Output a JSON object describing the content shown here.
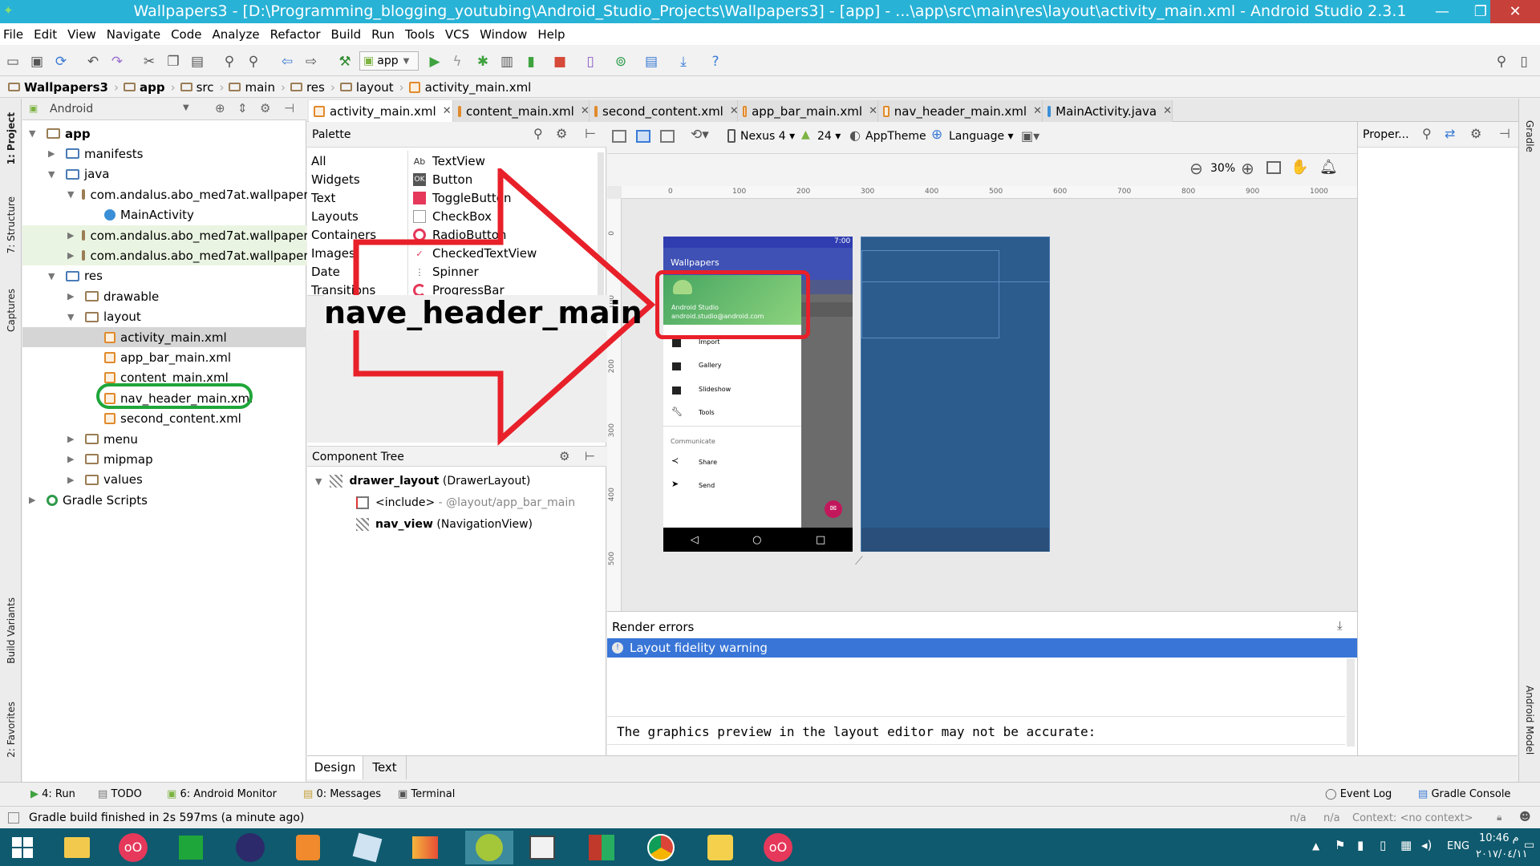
{
  "window": {
    "title": "Wallpapers3 - [D:\\Programming_blogging_youtubing\\Android_Studio_Projects\\Wallpapers3] - [app] - ...\\app\\src\\main\\res\\layout\\activity_main.xml - Android Studio 2.3.1",
    "controls": {
      "minimize": "—",
      "maximize": "❐",
      "close": "✕"
    }
  },
  "menu": [
    "File",
    "Edit",
    "View",
    "Navigate",
    "Code",
    "Analyze",
    "Refactor",
    "Build",
    "Run",
    "Tools",
    "VCS",
    "Window",
    "Help"
  ],
  "toolbar": {
    "run_config": "app"
  },
  "breadcrumb": [
    "Wallpapers3",
    "app",
    "src",
    "main",
    "res",
    "layout",
    "activity_main.xml"
  ],
  "left_tool_tabs": [
    "1: Project",
    "7: Structure",
    "Captures",
    "Build Variants",
    "2: Favorites"
  ],
  "right_tool_tabs": [
    "Gradle",
    "Android Model"
  ],
  "project": {
    "view_mode": "Android",
    "tree": [
      {
        "label": "app",
        "depth": 0,
        "open": true,
        "kind": "module"
      },
      {
        "label": "manifests",
        "depth": 1,
        "open": false,
        "kind": "folder"
      },
      {
        "label": "java",
        "depth": 1,
        "open": true,
        "kind": "folder"
      },
      {
        "label": "com.andalus.abo_med7at.wallpapers",
        "depth": 2,
        "open": true,
        "kind": "package"
      },
      {
        "label": "MainActivity",
        "depth": 3,
        "kind": "class"
      },
      {
        "label": "com.andalus.abo_med7at.wallpapers",
        "depth": 2,
        "open": false,
        "kind": "package",
        "highlight": true
      },
      {
        "label": "com.andalus.abo_med7at.wallpapers",
        "depth": 2,
        "open": false,
        "kind": "package",
        "highlight": true
      },
      {
        "label": "res",
        "depth": 1,
        "open": true,
        "kind": "folder"
      },
      {
        "label": "drawable",
        "depth": 2,
        "open": false,
        "kind": "folder"
      },
      {
        "label": "layout",
        "depth": 2,
        "open": true,
        "kind": "folder"
      },
      {
        "label": "activity_main.xml",
        "depth": 3,
        "kind": "xml",
        "selected": true
      },
      {
        "label": "app_bar_main.xml",
        "depth": 3,
        "kind": "xml"
      },
      {
        "label": "content_main.xml",
        "depth": 3,
        "kind": "xml"
      },
      {
        "label": "nav_header_main.xml",
        "depth": 3,
        "kind": "xml",
        "circled": true
      },
      {
        "label": "second_content.xml",
        "depth": 3,
        "kind": "xml"
      },
      {
        "label": "menu",
        "depth": 2,
        "open": false,
        "kind": "folder"
      },
      {
        "label": "mipmap",
        "depth": 2,
        "open": false,
        "kind": "folder"
      },
      {
        "label": "values",
        "depth": 2,
        "open": false,
        "kind": "folder"
      },
      {
        "label": "Gradle Scripts",
        "depth": 0,
        "open": false,
        "kind": "gradle"
      }
    ]
  },
  "editor_tabs": [
    {
      "label": "activity_main.xml",
      "active": true
    },
    {
      "label": "content_main.xml",
      "active": false
    },
    {
      "label": "second_content.xml",
      "active": false
    },
    {
      "label": "app_bar_main.xml",
      "active": false
    },
    {
      "label": "nav_header_main.xml",
      "active": false
    },
    {
      "label": "MainActivity.java",
      "active": false
    }
  ],
  "palette": {
    "title": "Palette",
    "categories": [
      "All",
      "Widgets",
      "Text",
      "Layouts",
      "Containers",
      "Images",
      "Date",
      "Transitions"
    ],
    "items": [
      {
        "icon": "Ab",
        "label": "TextView"
      },
      {
        "icon": "OK",
        "label": "Button"
      },
      {
        "icon": "",
        "label": "ToggleButton"
      },
      {
        "icon": "",
        "label": "CheckBox"
      },
      {
        "icon": "",
        "label": "RadioButton"
      },
      {
        "icon": "",
        "label": "CheckedTextView"
      },
      {
        "icon": "",
        "label": "Spinner"
      },
      {
        "icon": "",
        "label": "ProgressBar"
      }
    ]
  },
  "annotation": {
    "text": "nave_header_main",
    "arrow_color": "#e8202a",
    "circle_color": "#1fa63a"
  },
  "design_toolbar": {
    "device": "Nexus 4",
    "api": "24",
    "theme": "AppTheme",
    "language": "Language",
    "zoom": "30%"
  },
  "ruler": {
    "top": [
      "0",
      "100",
      "200",
      "300",
      "400",
      "500",
      "600",
      "700",
      "800",
      "900",
      "1000"
    ],
    "left": [
      "0",
      "100",
      "200",
      "300",
      "400",
      "500"
    ]
  },
  "phone": {
    "status_time": "7:00",
    "app_title": "Wallpapers",
    "header_name": "Android Studio",
    "header_email": "android.studio@android.com",
    "menu_items": [
      "Import",
      "Gallery",
      "Slideshow",
      "Tools"
    ],
    "section": "Communicate",
    "section_items": [
      "Share",
      "Send"
    ],
    "nav_buttons": [
      "◁",
      "○",
      "□"
    ]
  },
  "component_tree": {
    "title": "Component Tree",
    "nodes": [
      {
        "name": "drawer_layout",
        "type": "(DrawerLayout)"
      },
      {
        "name": "<include>",
        "type": "- @layout/app_bar_main"
      },
      {
        "name": "nav_view",
        "type": "(NavigationView)"
      }
    ]
  },
  "properties": {
    "title": "Proper..."
  },
  "render": {
    "title": "Render errors",
    "warning": "Layout fidelity warning",
    "message": "The graphics preview in the layout editor may not be accurate:"
  },
  "design_text_tabs": [
    "Design",
    "Text"
  ],
  "bottom_tool_windows": [
    {
      "label": "4: Run"
    },
    {
      "label": "TODO"
    },
    {
      "label": "6: Android Monitor"
    },
    {
      "label": "0: Messages"
    },
    {
      "label": "Terminal"
    }
  ],
  "bottom_right_tools": [
    "Event Log",
    "Gradle Console"
  ],
  "status": {
    "message": "Gradle build finished in 2s 597ms (a minute ago)",
    "na1": "n/a",
    "na2": "n/a",
    "context": "Context: <no context>"
  },
  "taskbar": {
    "lang": "ENG",
    "time": "10:46 م",
    "date": "٢٠١٧/٠٤/١١"
  }
}
